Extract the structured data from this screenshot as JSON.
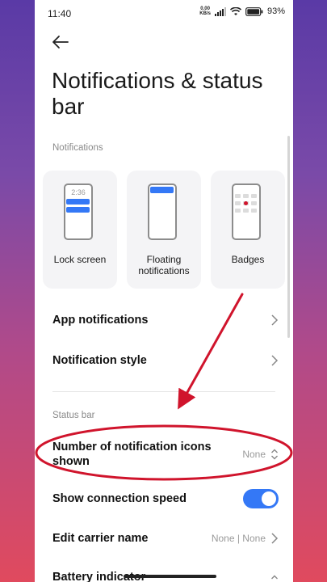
{
  "status_bar": {
    "time": "11:40",
    "speed_value": "0.00",
    "speed_unit": "KB/s",
    "battery": "93"
  },
  "page": {
    "title": "Notifications & status bar"
  },
  "notifications_section": {
    "label": "Notifications",
    "cards": [
      {
        "label": "Lock screen",
        "clock": "2:36"
      },
      {
        "label": "Floating notifications"
      },
      {
        "label": "Badges"
      }
    ]
  },
  "menu": {
    "app_notifications": "App notifications",
    "notification_style": "Notification style"
  },
  "status_bar_section": {
    "label": "Status bar",
    "icons_shown_label": "Number of notification icons shown",
    "icons_shown_value": "None",
    "connection_speed_label": "Show connection speed",
    "connection_speed_on": true,
    "carrier_label": "Edit carrier name",
    "carrier_value": "None | None",
    "battery_label": "Battery indicator"
  },
  "colors": {
    "accent": "#3478f6",
    "annotation": "#d0142c"
  }
}
